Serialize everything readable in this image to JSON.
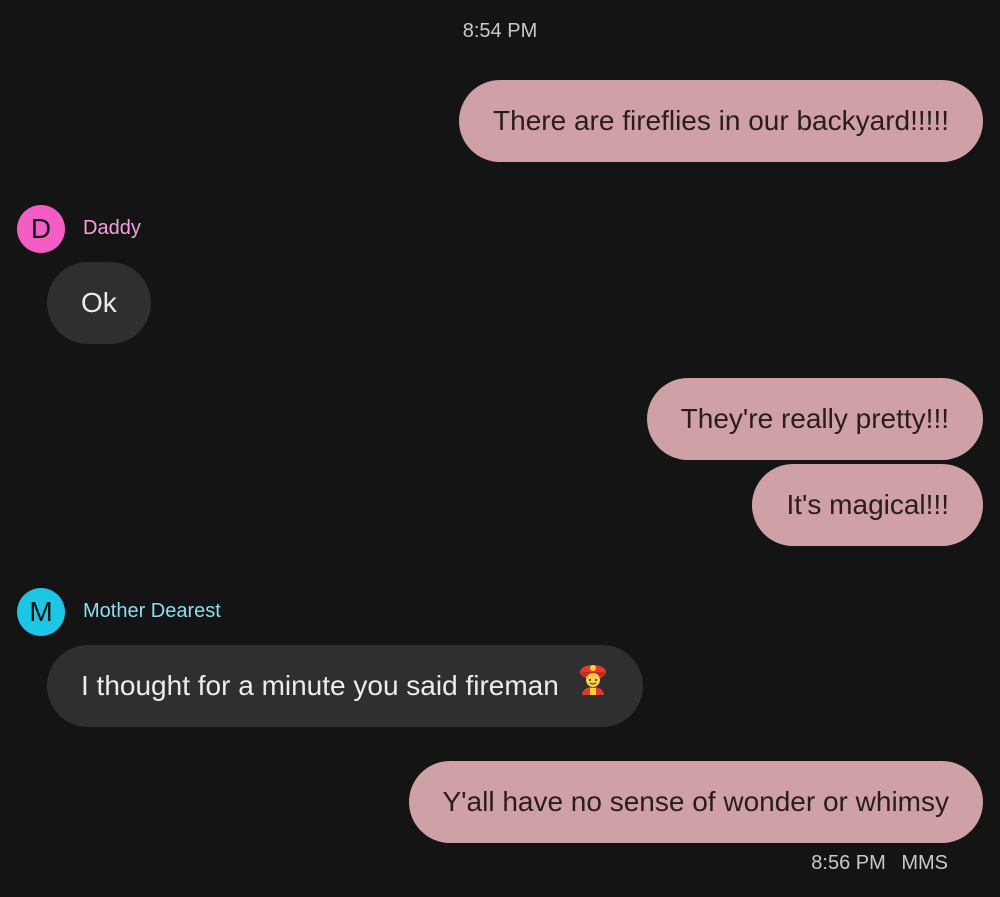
{
  "conversation": {
    "top_timestamp": "8:54 PM",
    "messages": [
      {
        "text": "There are fireflies in our backyard!!!!!"
      },
      {
        "sender": "Daddy",
        "initial": "D",
        "text": "Ok"
      },
      {
        "text": "They're really pretty!!!"
      },
      {
        "text": "It's magical!!!"
      },
      {
        "sender": "Mother Dearest",
        "initial": "M",
        "text": "I thought for a minute you said fireman",
        "emoji": "firefighter-emoji"
      },
      {
        "text": "Y'all have no sense of wonder or whimsy"
      }
    ],
    "footer_time": "8:56 PM",
    "footer_type": "MMS"
  },
  "colors": {
    "background": "#141414",
    "outgoing_bubble": "#cfa1a6",
    "incoming_bubble": "#2f2f31",
    "daddy_avatar": "#f25ec4",
    "daddy_name": "#f7a0e0",
    "mother_avatar": "#1ec6e6",
    "mother_name": "#8fdcf0"
  }
}
